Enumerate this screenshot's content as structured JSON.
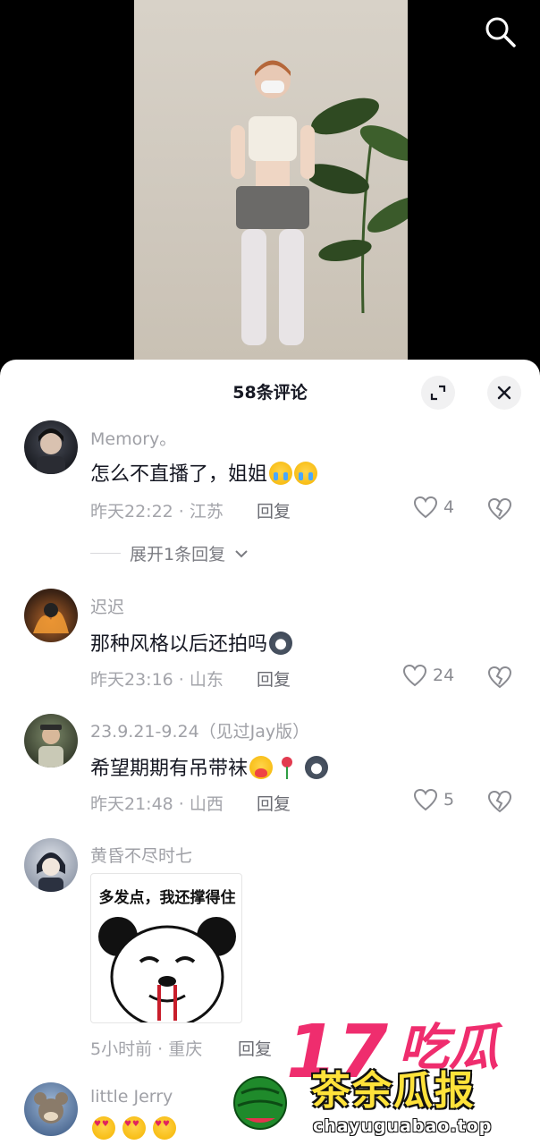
{
  "header": {
    "title": "58条评论"
  },
  "comments": [
    {
      "user": "Memory。",
      "text": "怎么不直播了，姐姐",
      "emojis": [
        "cry-emoji",
        "cry-emoji"
      ],
      "meta": "昨天22:22 · 江苏",
      "reply": "回复",
      "likes": "4",
      "expand": "展开1条回复"
    },
    {
      "user": "迟迟",
      "text": "那种风格以后还拍吗",
      "emojis": [
        "husky-emoji"
      ],
      "meta": "昨天23:16 · 山东",
      "reply": "回复",
      "likes": "24"
    },
    {
      "user": "23.9.21-9.24（见过Jay版）",
      "text": "希望期期有吊带袜",
      "emojis": [
        "heart-hug-emoji",
        "rose-emoji",
        "husky-emoji"
      ],
      "meta": "昨天21:48 · 山西",
      "reply": "回复",
      "likes": "5"
    },
    {
      "user": "黄昏不尽时七",
      "sticker_caption": "多发点，我还撑得住",
      "meta": "5小时前 · 重庆",
      "reply": "回复"
    },
    {
      "user": "little Jerry",
      "emojis": [
        "heart-eyes-emoji",
        "heart-eyes-emoji",
        "heart-eyes-emoji"
      ]
    }
  ],
  "watermark": {
    "line1": "17",
    "line2": "吃瓜",
    "main": "茶余瓜报",
    "url": "chayuguabao.top"
  }
}
